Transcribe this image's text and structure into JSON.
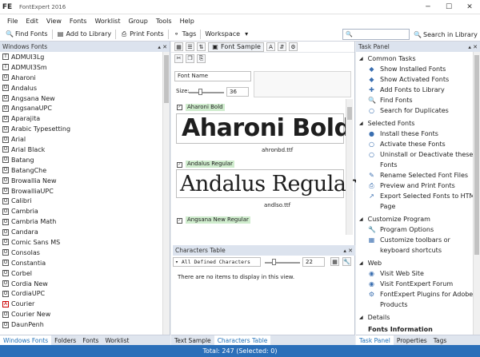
{
  "window": {
    "app_logo": "FE",
    "title": "FontExpert 2016",
    "controls": [
      "─",
      "☐",
      "✕"
    ]
  },
  "menu": [
    "File",
    "Edit",
    "View",
    "Fonts",
    "Worklist",
    "Group",
    "Tools",
    "Help"
  ],
  "toolbar": {
    "find_fonts": "Find Fonts",
    "add_to_library": "Add to Library",
    "print_fonts": "Print Fonts",
    "tags": "Tags",
    "workspace": "Workspace",
    "search_in_library": "Search in Library"
  },
  "left_panel": {
    "title": "Windows Fonts",
    "fonts": [
      {
        "name": "ADMUI3Lg",
        "type": "t"
      },
      {
        "name": "ADMUI3Sm",
        "type": "t"
      },
      {
        "name": "Aharoni",
        "type": "o"
      },
      {
        "name": "Andalus",
        "type": "o"
      },
      {
        "name": "Angsana New",
        "type": "o"
      },
      {
        "name": "AngsanaUPC",
        "type": "o"
      },
      {
        "name": "Aparajita",
        "type": "o"
      },
      {
        "name": "Arabic Typesetting",
        "type": "o"
      },
      {
        "name": "Arial",
        "type": "o"
      },
      {
        "name": "Arial Black",
        "type": "o"
      },
      {
        "name": "Batang",
        "type": "o"
      },
      {
        "name": "BatangChe",
        "type": "o"
      },
      {
        "name": "Browallia New",
        "type": "o"
      },
      {
        "name": "BrowalliaUPC",
        "type": "o"
      },
      {
        "name": "Calibri",
        "type": "o"
      },
      {
        "name": "Cambria",
        "type": "o"
      },
      {
        "name": "Cambria Math",
        "type": "o"
      },
      {
        "name": "Candara",
        "type": "o"
      },
      {
        "name": "Comic Sans MS",
        "type": "o"
      },
      {
        "name": "Consolas",
        "type": "o"
      },
      {
        "name": "Constantia",
        "type": "o"
      },
      {
        "name": "Corbel",
        "type": "o"
      },
      {
        "name": "Cordia New",
        "type": "o"
      },
      {
        "name": "CordiaUPC",
        "type": "o"
      },
      {
        "name": "Courier",
        "type": "a"
      },
      {
        "name": "Courier New",
        "type": "o"
      },
      {
        "name": "DaunPenh",
        "type": "o"
      }
    ],
    "tabs": [
      "Windows Fonts",
      "Folders",
      "Fonts",
      "Worklist"
    ]
  },
  "center": {
    "font_sample_btn": "Font Sample",
    "font_name_field": "Font Name",
    "size_label": "Size:",
    "size_value": "36",
    "samples": [
      {
        "label": "Aharoni Bold",
        "text": "Aharoni Bold",
        "file": "ahronbd.ttf"
      },
      {
        "label": "Andalus Regular",
        "text": "Andalus Regular",
        "file": "andlso.ttf"
      },
      {
        "label": "Angsana New Regular"
      }
    ],
    "chars_title": "Characters Table",
    "chars_filter": "All Defined Characters",
    "chars_size": "22",
    "chars_empty": "There are no items to display in this view.",
    "tabs": [
      "Text Sample",
      "Characters Table"
    ]
  },
  "task_panel": {
    "title": "Task Panel",
    "sections": [
      {
        "title": "Common Tasks",
        "items": [
          "Show Installed Fonts",
          "Show Activated Fonts",
          "Add Fonts to Library",
          "Find Fonts",
          "Search for Duplicates"
        ]
      },
      {
        "title": "Selected Fonts",
        "items": [
          "Install these Fonts",
          "Activate these Fonts",
          "Uninstall or Deactivate these Fonts",
          "Rename Selected Font Files",
          "Preview and Print Fonts",
          "Export Selected Fonts to HTML Page"
        ]
      },
      {
        "title": "Customize Program",
        "items": [
          "Program Options",
          "Customize toolbars or keyboard shortcuts"
        ]
      },
      {
        "title": "Web",
        "items": [
          "Visit Web Site",
          "Visit FontExpert Forum",
          "FontExpert Plugins for Adobe Products"
        ]
      },
      {
        "title": "Details",
        "items": []
      }
    ],
    "details_heading": "Fonts Information",
    "tabs": [
      "Task Panel",
      "Properties",
      "Tags"
    ]
  },
  "status": "Total: 247 (Selected: 0)"
}
